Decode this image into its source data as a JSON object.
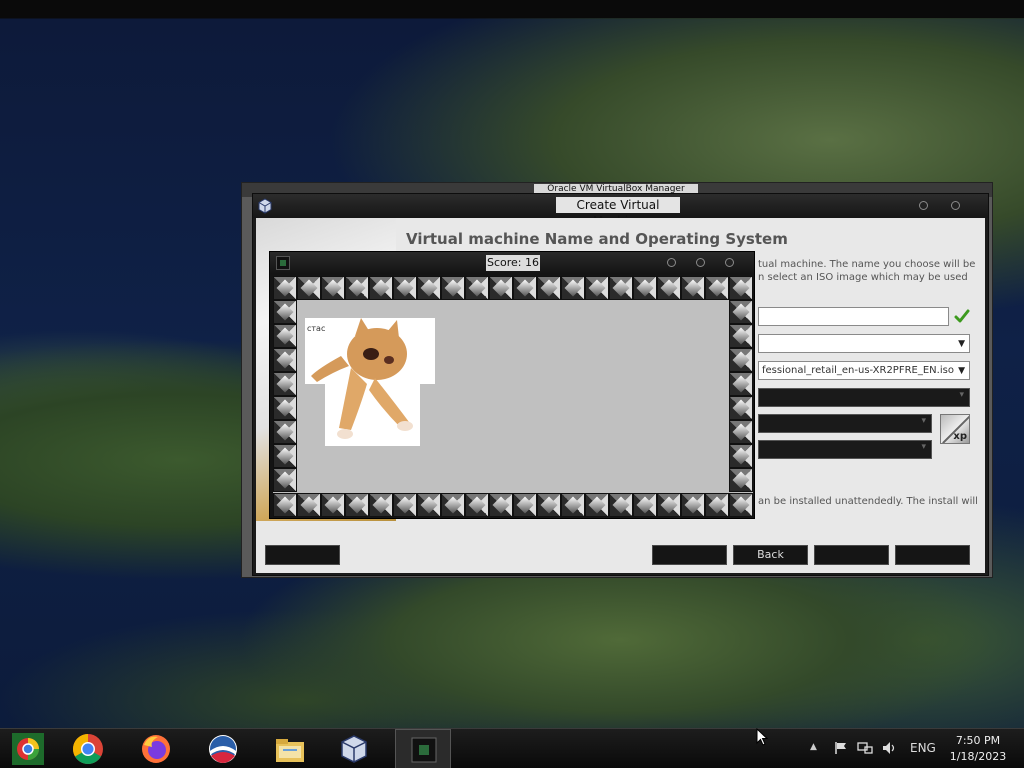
{
  "background_window": {
    "title": "Oracle VM VirtualBox Manager"
  },
  "create_vm": {
    "title": "Create Virtual Machine",
    "heading": "Virtual machine Name and Operating System",
    "description": "tual machine. The name you choose will be\nn select an ISO image which may be used",
    "name_value": "",
    "folder_value": "",
    "iso_value": "fessional_retail_en-us-XR2PFRE_EN.iso",
    "os_badge_text": "xp",
    "unattended_note": "an be installed unattendedly. The install will",
    "buttons": {
      "help": "",
      "expert": "",
      "back": "Back",
      "next": "",
      "cancel": ""
    }
  },
  "game": {
    "score_label": "Score: 16",
    "sprite_caption": "стас"
  },
  "taskbar": {
    "apps": [
      "start-icon",
      "chrome-icon",
      "firefox-icon",
      "obama-logo-icon",
      "file-explorer-icon",
      "virtualbox-icon",
      "game-icon"
    ],
    "language": "ENG",
    "time": "7:50 PM",
    "date": "1/18/2023"
  },
  "colors": {
    "accent_green": "#3c9a1e",
    "dialog_bg": "#e8e8e8",
    "game_bg": "#c0c0c0",
    "taskbar_bg": "#111111"
  }
}
